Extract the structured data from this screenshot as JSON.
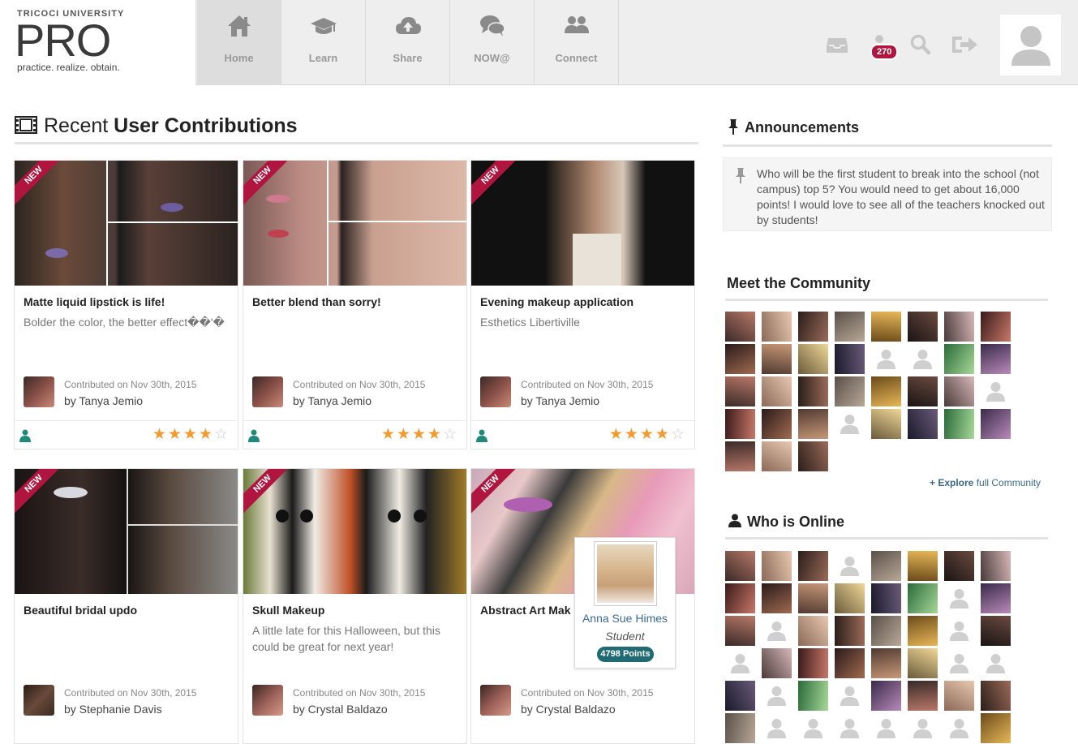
{
  "logo": {
    "university": "TRICOCI UNIVERSITY",
    "brand": "PRO",
    "tagline": "practice. realize. obtain."
  },
  "nav": [
    {
      "label": "Home",
      "icon": "home-icon",
      "active": true
    },
    {
      "label": "Learn",
      "icon": "graduation-cap-icon",
      "active": false
    },
    {
      "label": "Share",
      "icon": "cloud-upload-icon",
      "active": false
    },
    {
      "label": "NOW@",
      "icon": "chat-bubbles-icon",
      "active": false
    },
    {
      "label": "Connect",
      "icon": "users-icon",
      "active": false
    }
  ],
  "header": {
    "notifications_count": "270"
  },
  "contributions": {
    "title_plain": "Recent ",
    "title_bold": "User Contributions",
    "ribbon": "NEW",
    "cards": [
      {
        "title": "Matte liquid lipstick is life!",
        "desc": "Bolder the color, the better effect��'�",
        "contributed": "Contributed on Nov 30th, 2015",
        "by": "by Tanya Jemio",
        "rating": 4
      },
      {
        "title": "Better blend than sorry!",
        "desc": "",
        "contributed": "Contributed on Nov 30th, 2015",
        "by": "by Tanya Jemio",
        "rating": 4
      },
      {
        "title": "Evening makeup application",
        "desc": "Esthetics Libertiville",
        "contributed": "Contributed on Nov 30th, 2015",
        "by": "by Tanya Jemio",
        "rating": 4
      },
      {
        "title": "Beautiful bridal updo",
        "desc": "",
        "contributed": "Contributed on Nov 30th, 2015",
        "by": "by Stephanie Davis",
        "rating": 0
      },
      {
        "title": "Skull Makeup",
        "desc": "A little late for this Halloween, but this could be great for next year!",
        "contributed": "Contributed on Nov 30th, 2015",
        "by": "by Crystal Baldazo",
        "rating": 0
      },
      {
        "title": "Abstract Art Mak",
        "desc": "",
        "contributed": "Contributed on Nov 30th, 2015",
        "by": "by Crystal Baldazo",
        "rating": 0
      }
    ]
  },
  "announcements": {
    "title": "Announcements",
    "text": "Who will be the first student to break into the school (not campus) top 5? You would need to get about 16,000 points! I would love to see all of the teachers knocked out by students!"
  },
  "community": {
    "title": "Meet the Community",
    "explore_bold": "+ Explore",
    "explore_rest": " full Community"
  },
  "online": {
    "title": "Who is Online"
  },
  "popup": {
    "name": "Anna Sue Himes",
    "role": "Student",
    "points": "4798 Points"
  },
  "colors": {
    "accent": "#b0153f",
    "teal": "#1f8a7a",
    "star": "#f29a2e",
    "link": "#3a6a8a"
  }
}
